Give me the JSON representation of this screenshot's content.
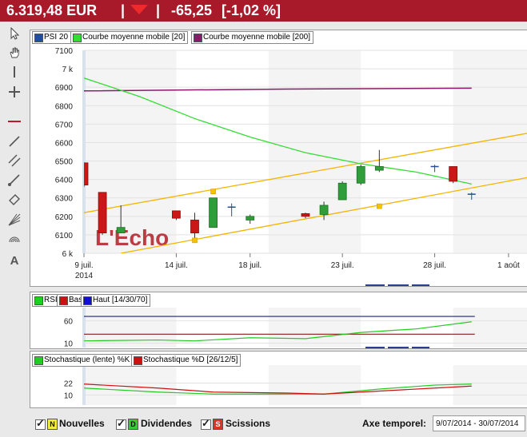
{
  "header": {
    "price": "6.319,48 EUR",
    "separator": "|",
    "change": "-65,25",
    "change_pct": "[-1,02 %]",
    "down_color": "#ee2a2a"
  },
  "toolbar": {
    "tools": [
      "cursor-icon",
      "hand-icon",
      "vertical-line-icon",
      "crosshair-icon",
      "horizontal-line-icon",
      "trend-line-icon",
      "channel-icon",
      "ray-icon",
      "rectangle-icon",
      "fibonacci-fan-icon",
      "fibonacci-arc-icon",
      "text-icon"
    ]
  },
  "watermark": "L'Echo",
  "main_legend": {
    "items": [
      {
        "label": "PSI 20",
        "color": "#1f4ea0"
      },
      {
        "label": "Courbe moyenne mobile  [20]",
        "color": "#33dd33"
      },
      {
        "label": "Courbe moyenne mobile  [200]",
        "color": "#8a1a6a"
      }
    ]
  },
  "rsi_legend": {
    "items": [
      {
        "label": "RSI",
        "color": "#22cc22"
      },
      {
        "label": "Bas",
        "color": "#cc1111"
      },
      {
        "label": "Haut  [14/30/70]",
        "color": "#1111cc"
      }
    ]
  },
  "stoch_legend": {
    "items": [
      {
        "label": "Stochastique (lente) %K",
        "color": "#22cc22"
      },
      {
        "label": "Stochastique %D  [26/12/5]",
        "color": "#cc1111"
      }
    ]
  },
  "chart_data": [
    {
      "type": "candlestick",
      "series_name": "PSI 20",
      "yticks": [
        "7100",
        "7 k",
        "6900",
        "6800",
        "6700",
        "6600",
        "6500",
        "6400",
        "6300",
        "6200",
        "6100",
        "6 k"
      ],
      "ytick_values": [
        7100,
        7000,
        6900,
        6800,
        6700,
        6600,
        6500,
        6400,
        6300,
        6200,
        6100,
        6000
      ],
      "ylim": [
        6000,
        7100
      ],
      "xlim": [
        "2014-07-09",
        "2014-08-02"
      ],
      "xticks": [
        {
          "date": "2014-07-09",
          "label": "9 juil.",
          "sublabel": "2014"
        },
        {
          "date": "2014-07-14",
          "label": "14 juil."
        },
        {
          "date": "2014-07-18",
          "label": "18 juil."
        },
        {
          "date": "2014-07-23",
          "label": "23 juil."
        },
        {
          "date": "2014-07-28",
          "label": "28 juil."
        },
        {
          "date": "2014-08-01",
          "label": "1 août"
        }
      ],
      "candles": [
        {
          "date": "2014-07-09",
          "open": 6490,
          "high": 6490,
          "low": 6360,
          "close": 6370
        },
        {
          "date": "2014-07-10",
          "open": 6330,
          "high": 6330,
          "low": 6100,
          "close": 6110
        },
        {
          "date": "2014-07-11",
          "open": 6110,
          "high": 6260,
          "low": 6110,
          "close": 6140
        },
        {
          "date": "2014-07-14",
          "open": 6230,
          "high": 6230,
          "low": 6180,
          "close": 6190
        },
        {
          "date": "2014-07-15",
          "open": 6180,
          "high": 6220,
          "low": 6080,
          "close": 6110
        },
        {
          "date": "2014-07-16",
          "open": 6140,
          "high": 6300,
          "low": 6140,
          "close": 6300
        },
        {
          "date": "2014-07-17",
          "open": 6250,
          "high": 6270,
          "low": 6200,
          "close": 6250
        },
        {
          "date": "2014-07-18",
          "open": 6180,
          "high": 6210,
          "low": 6160,
          "close": 6200
        },
        {
          "date": "2014-07-21",
          "open": 6215,
          "high": 6220,
          "low": 6190,
          "close": 6200
        },
        {
          "date": "2014-07-22",
          "open": 6210,
          "high": 6280,
          "low": 6180,
          "close": 6260
        },
        {
          "date": "2014-07-23",
          "open": 6290,
          "high": 6390,
          "low": 6290,
          "close": 6380
        },
        {
          "date": "2014-07-24",
          "open": 6380,
          "high": 6480,
          "low": 6370,
          "close": 6470
        },
        {
          "date": "2014-07-25",
          "open": 6450,
          "high": 6560,
          "low": 6440,
          "close": 6470
        },
        {
          "date": "2014-07-28",
          "open": 6470,
          "high": 6480,
          "low": 6440,
          "close": 6470
        },
        {
          "date": "2014-07-29",
          "open": 6470,
          "high": 6470,
          "low": 6380,
          "close": 6390
        },
        {
          "date": "2014-07-30",
          "open": 6320,
          "high": 6330,
          "low": 6290,
          "close": 6320
        }
      ],
      "ma20": [
        {
          "date": "2014-07-09",
          "v": 6950
        },
        {
          "date": "2014-07-12",
          "v": 6850
        },
        {
          "date": "2014-07-15",
          "v": 6730
        },
        {
          "date": "2014-07-18",
          "v": 6630
        },
        {
          "date": "2014-07-21",
          "v": 6545
        },
        {
          "date": "2014-07-24",
          "v": 6485
        },
        {
          "date": "2014-07-27",
          "v": 6440
        },
        {
          "date": "2014-07-30",
          "v": 6375
        }
      ],
      "ma200": [
        {
          "date": "2014-07-09",
          "v": 6880
        },
        {
          "date": "2014-07-20",
          "v": 6890
        },
        {
          "date": "2014-07-30",
          "v": 6895
        }
      ],
      "trend_lines": [
        {
          "from": {
            "date": "2014-07-09",
            "v": 6220
          },
          "to": {
            "date": "2014-08-02",
            "v": 6650
          }
        },
        {
          "from": {
            "date": "2014-07-11",
            "v": 6000
          },
          "to": {
            "date": "2014-08-02",
            "v": 6410
          }
        }
      ],
      "markers": [
        {
          "date": "2014-07-15",
          "v": 6070
        },
        {
          "date": "2014-07-16",
          "v": 6335
        },
        {
          "date": "2014-07-25",
          "v": 6255
        }
      ]
    },
    {
      "type": "line",
      "name": "RSI",
      "yticks": [
        60,
        10
      ],
      "ylim": [
        0,
        90
      ],
      "levels": {
        "low": 30,
        "high": 70
      },
      "series": [
        {
          "name": "RSI",
          "color": "#22cc22",
          "points": [
            {
              "date": "2014-07-09",
              "v": 15
            },
            {
              "date": "2014-07-13",
              "v": 17
            },
            {
              "date": "2014-07-15",
              "v": 15
            },
            {
              "date": "2014-07-18",
              "v": 22
            },
            {
              "date": "2014-07-21",
              "v": 20
            },
            {
              "date": "2014-07-24",
              "v": 34
            },
            {
              "date": "2014-07-27",
              "v": 42
            },
            {
              "date": "2014-07-30",
              "v": 58
            }
          ]
        }
      ]
    },
    {
      "type": "line",
      "name": "Stochastique",
      "yticks": [
        22,
        10
      ],
      "ylim": [
        0,
        40
      ],
      "series": [
        {
          "name": "Stochastique (lente) %K",
          "color": "#22cc22",
          "points": [
            {
              "date": "2014-07-09",
              "v": 17
            },
            {
              "date": "2014-07-13",
              "v": 13
            },
            {
              "date": "2014-07-16",
              "v": 11
            },
            {
              "date": "2014-07-20",
              "v": 11
            },
            {
              "date": "2014-07-22",
              "v": 11
            },
            {
              "date": "2014-07-25",
              "v": 16
            },
            {
              "date": "2014-07-28",
              "v": 20
            },
            {
              "date": "2014-07-30",
              "v": 21
            }
          ]
        },
        {
          "name": "Stochastique %D  [26/12/5]",
          "color": "#cc1111",
          "points": [
            {
              "date": "2014-07-09",
              "v": 21
            },
            {
              "date": "2014-07-13",
              "v": 17
            },
            {
              "date": "2014-07-16",
              "v": 13
            },
            {
              "date": "2014-07-20",
              "v": 12
            },
            {
              "date": "2014-07-22",
              "v": 11
            },
            {
              "date": "2014-07-25",
              "v": 14
            },
            {
              "date": "2014-07-28",
              "v": 17
            },
            {
              "date": "2014-07-30",
              "v": 19
            }
          ]
        }
      ]
    }
  ],
  "footer": {
    "news": {
      "letter": "N",
      "label": "Nouvelles",
      "color": "#f1ed3a"
    },
    "dividends": {
      "letter": "D",
      "label": "Dividendes",
      "color": "#33cc33"
    },
    "splits": {
      "letter": "S",
      "label": "Scissions",
      "color": "#dd3322"
    },
    "time_axis_label": "Axe temporel:",
    "date_range": "9/07/2014 - 30/07/2014"
  }
}
